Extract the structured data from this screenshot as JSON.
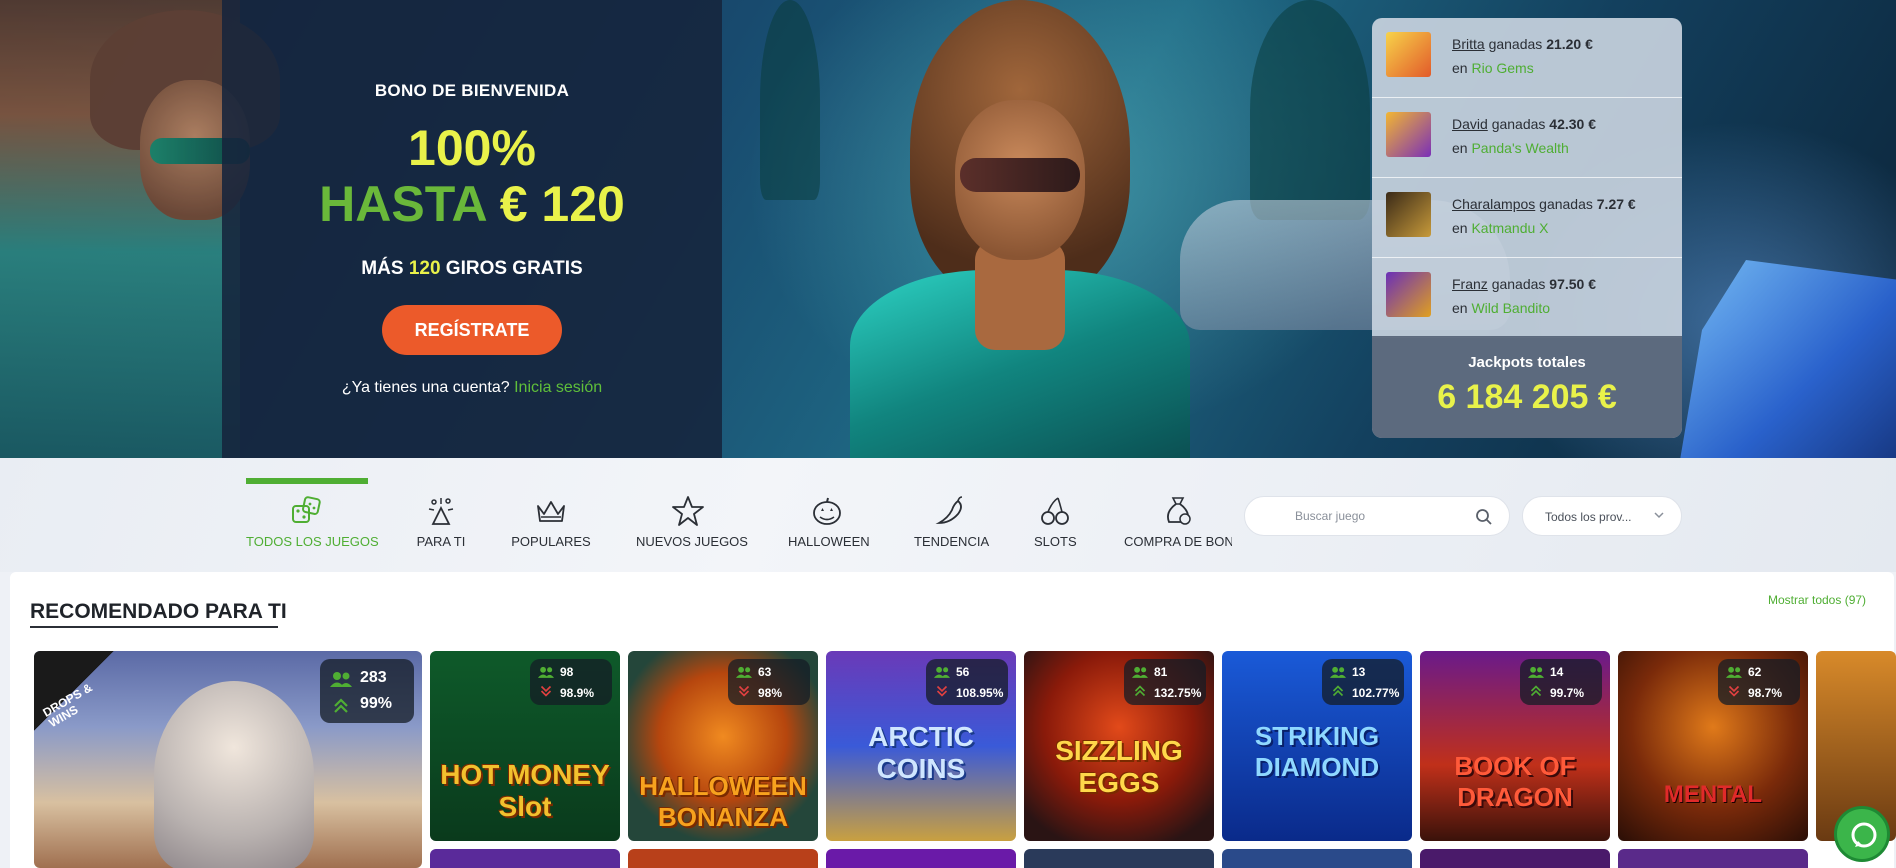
{
  "hero": {
    "bonus_label": "BONO DE BIENVENIDA",
    "percent": "100%",
    "upto_word": "HASTA",
    "upto_amount": "€ 120",
    "spins_prefix": "MÁS",
    "spins_count": "120",
    "spins_suffix": "GIROS GRATIS",
    "register_label": "REGÍSTRATE",
    "login_prompt": "¿Ya tienes una cuenta?",
    "login_link": "Inicia sesión"
  },
  "winners": {
    "won_word": "ganadas",
    "in_word": "en",
    "items": [
      {
        "name": "Britta",
        "amount": "21.20 €",
        "game": "Rio Gems"
      },
      {
        "name": "David",
        "amount": "42.30 €",
        "game": "Panda's Wealth"
      },
      {
        "name": "Charalampos",
        "amount": "7.27 €",
        "game": "Katmandu X"
      },
      {
        "name": "Franz",
        "amount": "97.50 €",
        "game": "Wild Bandito"
      }
    ],
    "jackpot_label": "Jackpots totales",
    "jackpot_value": "6 184 205 €"
  },
  "categories": {
    "items": [
      {
        "label": "TODOS LOS JUEGOS",
        "icon": "dice-icon"
      },
      {
        "label": "PARA TI",
        "icon": "confetti-icon"
      },
      {
        "label": "POPULARES",
        "icon": "crown-icon"
      },
      {
        "label": "NUEVOS JUEGOS",
        "icon": "star-icon"
      },
      {
        "label": "HALLOWEEN",
        "icon": "pumpkin-icon"
      },
      {
        "label": "TENDENCIA",
        "icon": "chili-icon"
      },
      {
        "label": "SLOTS",
        "icon": "cherries-icon"
      },
      {
        "label": "COMPRA DE BONO",
        "icon": "money-bag-icon"
      }
    ],
    "active": "TODOS LOS JUEGOS",
    "search_placeholder": "Buscar juego",
    "provider_value": "Todos los prov..."
  },
  "section": {
    "title": "RECOMENDADO PARA TI",
    "show_all_label": "Mostrar todos",
    "show_all_count": "(97)",
    "drops_badge": "DROPS & WINS"
  },
  "games": [
    {
      "name": "",
      "players": "283",
      "rtp": "99%"
    },
    {
      "name": "HOT MONEY Slot",
      "players": "98",
      "rtp": "98.9%"
    },
    {
      "name": "HALLOWEEN BONANZA",
      "players": "63",
      "rtp": "98%"
    },
    {
      "name": "ARCTIC COINS",
      "players": "56",
      "rtp": "108.95%"
    },
    {
      "name": "SIZZLING EGGS",
      "players": "81",
      "rtp": "132.75%"
    },
    {
      "name": "STRIKING DIAMOND",
      "players": "13",
      "rtp": "102.77%"
    },
    {
      "name": "BOOK OF DRAGON",
      "players": "14",
      "rtp": "99.7%"
    },
    {
      "name": "MENTAL",
      "players": "62",
      "rtp": "98.7%"
    }
  ],
  "colors": {
    "accent_green": "#4fae33",
    "accent_yellow": "#e9f24a",
    "cta_orange": "#ec5a2a"
  }
}
